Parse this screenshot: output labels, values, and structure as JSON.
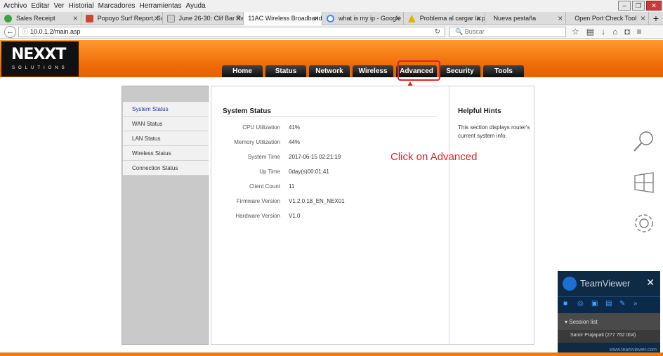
{
  "menubar": {
    "items": [
      "Archivo",
      "Editar",
      "Ver",
      "Historial",
      "Marcadores",
      "Herramientas",
      "Ayuda"
    ]
  },
  "tabs": [
    {
      "label": "Sales Receipt",
      "color": "#3aa43a"
    },
    {
      "label": "Popoyo Surf Report, Surf",
      "color": "#c84a2e"
    },
    {
      "label": "June 26-30: Clif Bar Rese",
      "color": "#cfcfcf"
    },
    {
      "label": "11AC Wireless Broadband Ro",
      "color": "#ffffff"
    },
    {
      "label": "what is my ip - Google S",
      "color": "#4285f4"
    },
    {
      "label": "Problema al cargar la pág",
      "color": "#e2b400"
    },
    {
      "label": "Nueva pestaña",
      "color": "#dddddd"
    },
    {
      "label": "Open Port Check Tool",
      "color": "#dddddd"
    }
  ],
  "url": "10.0.1.2/main.asp",
  "search_placeholder": "Buscar",
  "logo": {
    "name": "NEXXT",
    "sub": "SOLUTIONS"
  },
  "nav": [
    "Home",
    "Status",
    "Network",
    "Wireless",
    "Advanced",
    "Security",
    "Tools"
  ],
  "sidebar": [
    "System Status",
    "WAN Status",
    "LAN Status",
    "Wireless Status",
    "Connection Status"
  ],
  "main": {
    "title": "System Status",
    "rows": [
      {
        "label": "CPU Utilization",
        "value": "41%"
      },
      {
        "label": "Memory Utilization",
        "value": "44%"
      },
      {
        "label": "System Time",
        "value": "2017-06-15 02:21:19"
      },
      {
        "label": "Up Time",
        "value": "0day(s)00:01:41"
      },
      {
        "label": "Client Count",
        "value": "11"
      },
      {
        "label": "Firmware Version",
        "value": "V1.2.0.18_EN_NEX01"
      },
      {
        "label": "Hardware Version",
        "value": "V1.0"
      }
    ]
  },
  "hints": {
    "title": "Helpful Hints",
    "body": "This section displays router's current system info."
  },
  "annotation": "Click on Advanced",
  "teamviewer": {
    "brand": "TeamViewer",
    "session_label": "Session list",
    "user": "Samir Prajapati (277 762 004)",
    "website": "www.teamviewer.com"
  },
  "colors": {
    "accent": "#ef7a12",
    "highlight": "#e02424"
  }
}
